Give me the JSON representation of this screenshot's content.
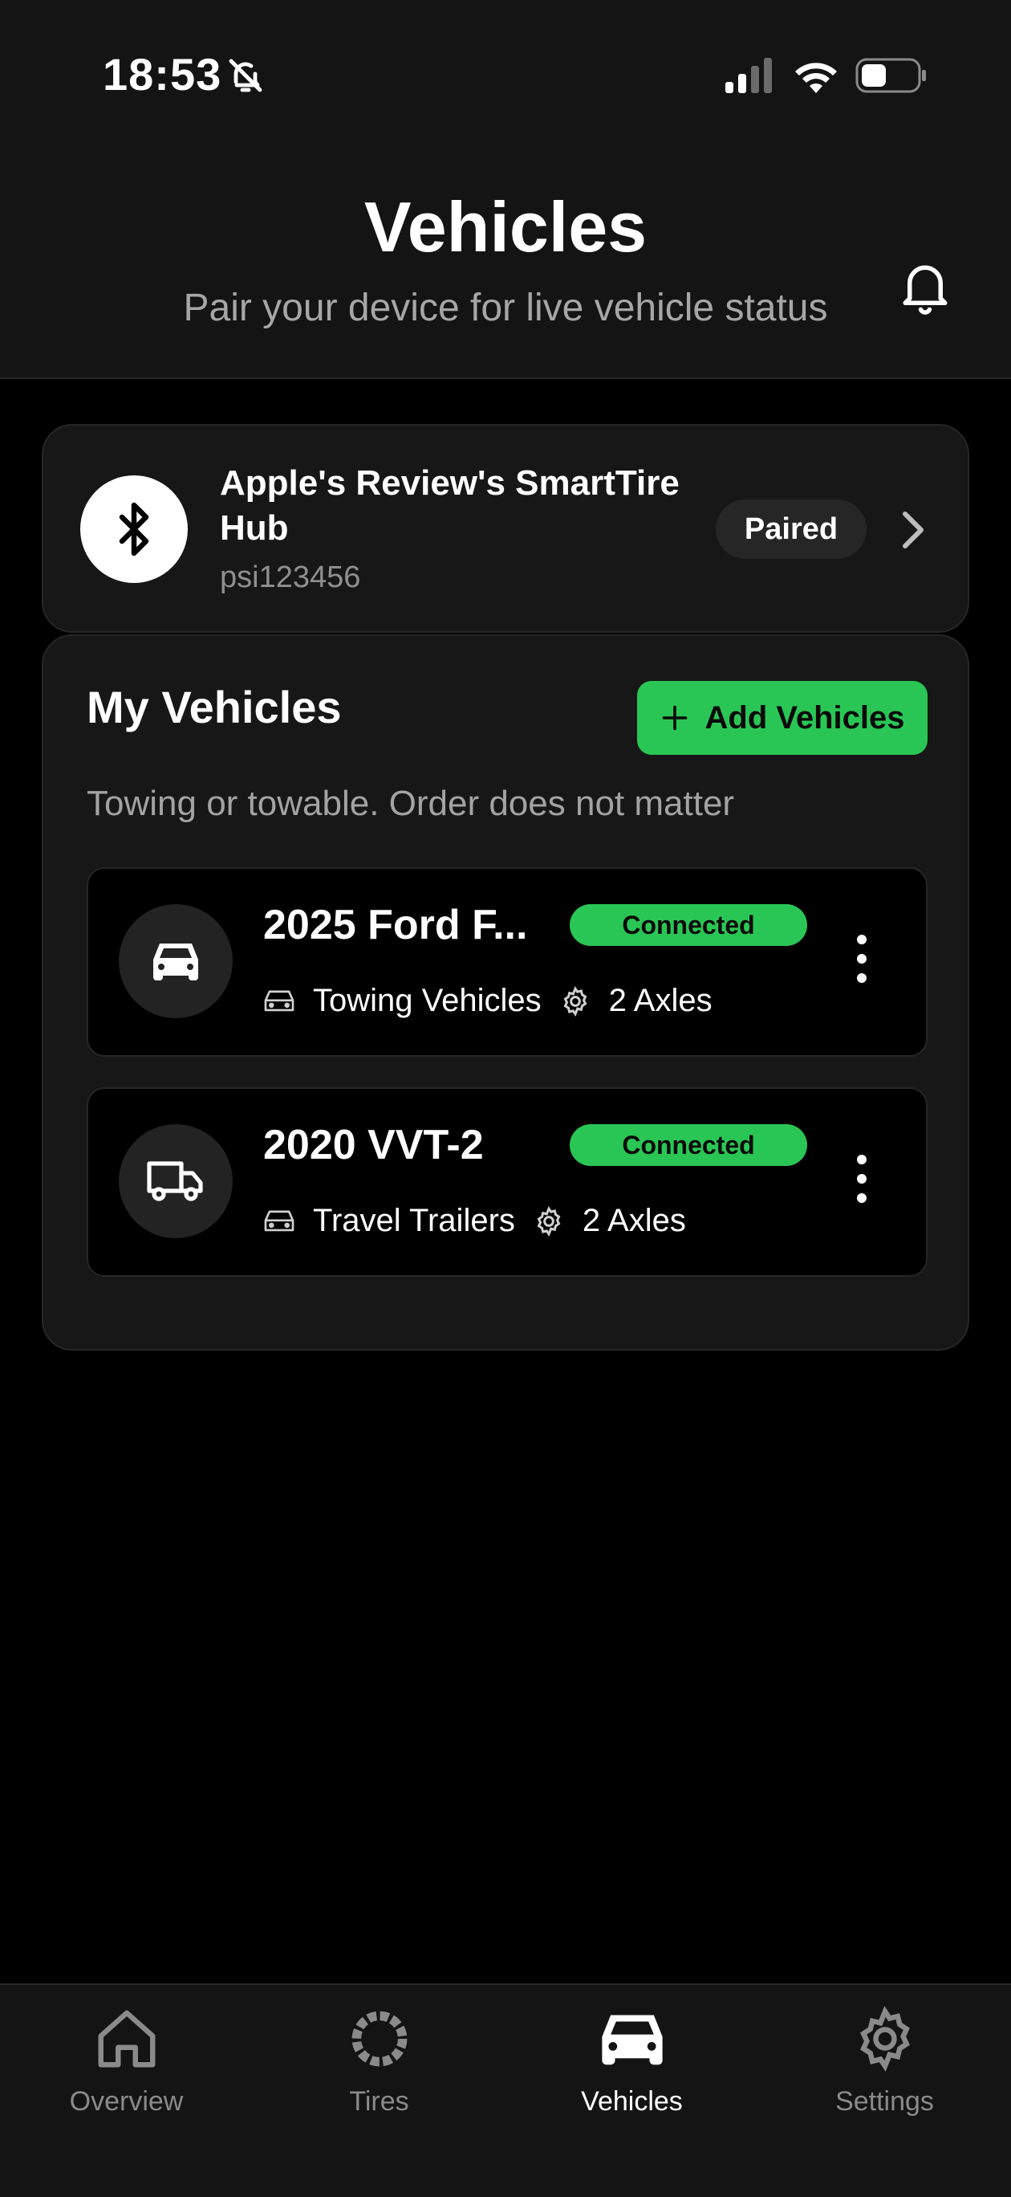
{
  "status_bar": {
    "time": "18:53"
  },
  "header": {
    "title": "Vehicles",
    "subtitle": "Pair your device for live vehicle status"
  },
  "hub": {
    "name": "Apple's Review's SmartTire Hub",
    "id": "psi123456",
    "status": "Paired",
    "icon": "bluetooth-icon"
  },
  "my_vehicles": {
    "title": "My Vehicles",
    "add_label": "Add Vehicles",
    "subtitle": "Towing or towable. Order does not matter",
    "items": [
      {
        "name": "2025 Ford F...",
        "status": "Connected",
        "type": "Towing Vehicles",
        "axles": "2 Axles",
        "icon": "car-icon"
      },
      {
        "name": "2020 VVT-2",
        "status": "Connected",
        "type": "Travel Trailers",
        "axles": "2 Axles",
        "icon": "truck-icon"
      }
    ]
  },
  "tabs": [
    {
      "label": "Overview",
      "icon": "home-icon",
      "active": false
    },
    {
      "label": "Tires",
      "icon": "tire-icon",
      "active": false
    },
    {
      "label": "Vehicles",
      "icon": "car-icon",
      "active": true
    },
    {
      "label": "Settings",
      "icon": "gear-icon",
      "active": false
    }
  ],
  "colors": {
    "accent": "#2ac655",
    "background": "#000000",
    "card": "#171717"
  }
}
